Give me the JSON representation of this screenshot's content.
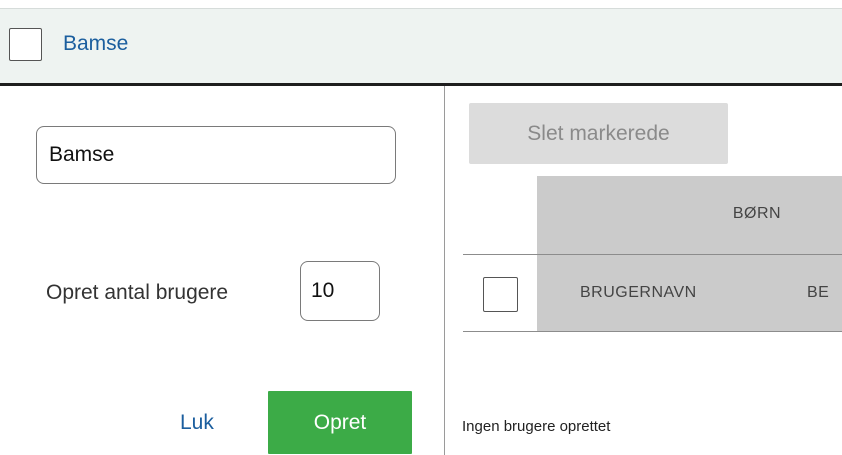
{
  "header": {
    "title": "Bamse"
  },
  "form": {
    "group_name_value": "Bamse",
    "count_label": "Opret antal brugere",
    "count_value": "10",
    "close_label": "Luk",
    "create_label": "Opret"
  },
  "table": {
    "delete_selected_label": "Slet markerede",
    "group_header": "BØRN",
    "columns": [
      "BRUGERNAVN",
      "BE"
    ],
    "empty_message": "Ingen brugere oprettet"
  },
  "colors": {
    "header_bg": "#eef3f1",
    "link": "#1b5e9e",
    "primary_button": "#3cab47",
    "disabled_button": "#dcdcdc",
    "table_header_bg": "#cbcbcb"
  }
}
